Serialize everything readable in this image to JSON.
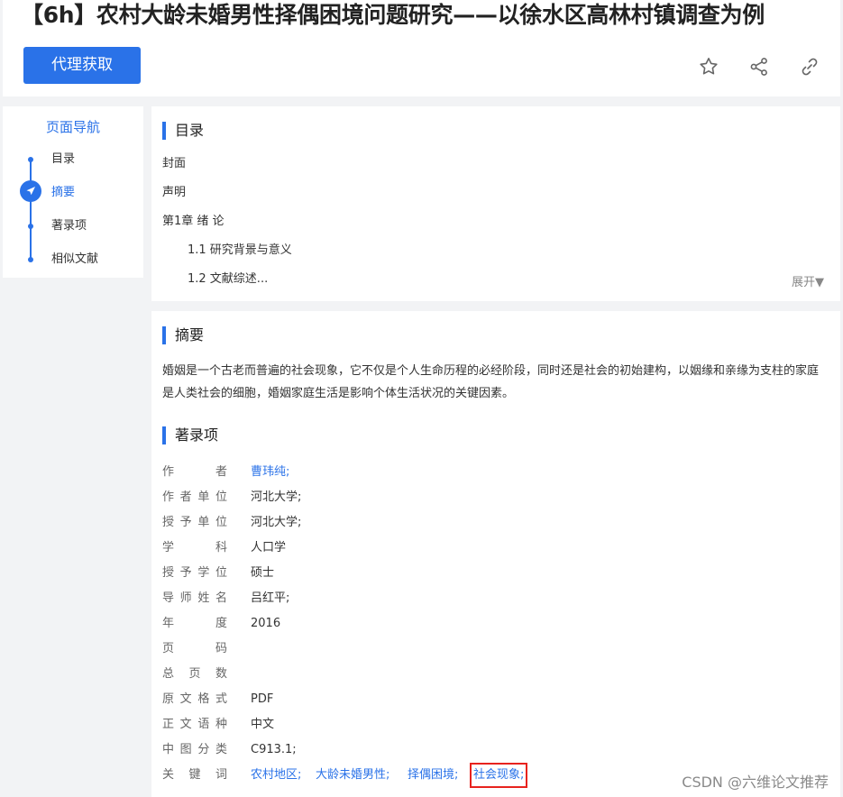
{
  "header": {
    "title": "【6h】农村大龄未婚男性择偶困境问题研究——以徐水区高林村镇调查为例",
    "proxy_button": "代理获取",
    "icons": [
      "star-icon",
      "share-icon",
      "link-icon"
    ]
  },
  "nav": {
    "title": "页面导航",
    "items": [
      {
        "label": "目录"
      },
      {
        "label": "摘要",
        "active": true
      },
      {
        "label": "著录项"
      },
      {
        "label": "相似文献"
      }
    ]
  },
  "toc": {
    "heading": "目录",
    "items": [
      "封面",
      "声明",
      "第1章 绪 论",
      "1.1 研究背景与意义",
      "1.2 文献综述..."
    ],
    "expand": "展开▼"
  },
  "abstract": {
    "heading": "摘要",
    "text": "婚姻是一个古老而普遍的社会现象，它不仅是个人生命历程的必经阶段，同时还是社会的初始建构，以姻缘和亲缘为支柱的家庭是人类社会的细胞，婚姻家庭生活是影响个体生活状况的关键因素。"
  },
  "record": {
    "heading": "著录项",
    "rows": [
      {
        "label": "作者",
        "value": "曹玮纯;"
      },
      {
        "label": "作者单位",
        "value": "河北大学;"
      },
      {
        "label": "授予单位",
        "value": "河北大学;"
      },
      {
        "label": "学科",
        "value": "人口学"
      },
      {
        "label": "授予学位",
        "value": "硕士"
      },
      {
        "label": "导师姓名",
        "value": "吕红平;"
      },
      {
        "label": "年度",
        "value": "2016"
      },
      {
        "label": "页码",
        "value": ""
      },
      {
        "label": "总页数",
        "value": ""
      },
      {
        "label": "原文格式",
        "value": "PDF"
      },
      {
        "label": "正文语种",
        "value": "中文"
      },
      {
        "label": "中图分类",
        "value": "C913.1;"
      }
    ],
    "keywords_label": "关键词",
    "keywords": [
      "农村地区;",
      "大龄未婚男性;",
      "择偶困境;",
      "社会现象;"
    ]
  },
  "watermark": "CSDN @六维论文推荐",
  "colors": {
    "accent": "#2a72e8",
    "highlight": "#e8231e"
  }
}
